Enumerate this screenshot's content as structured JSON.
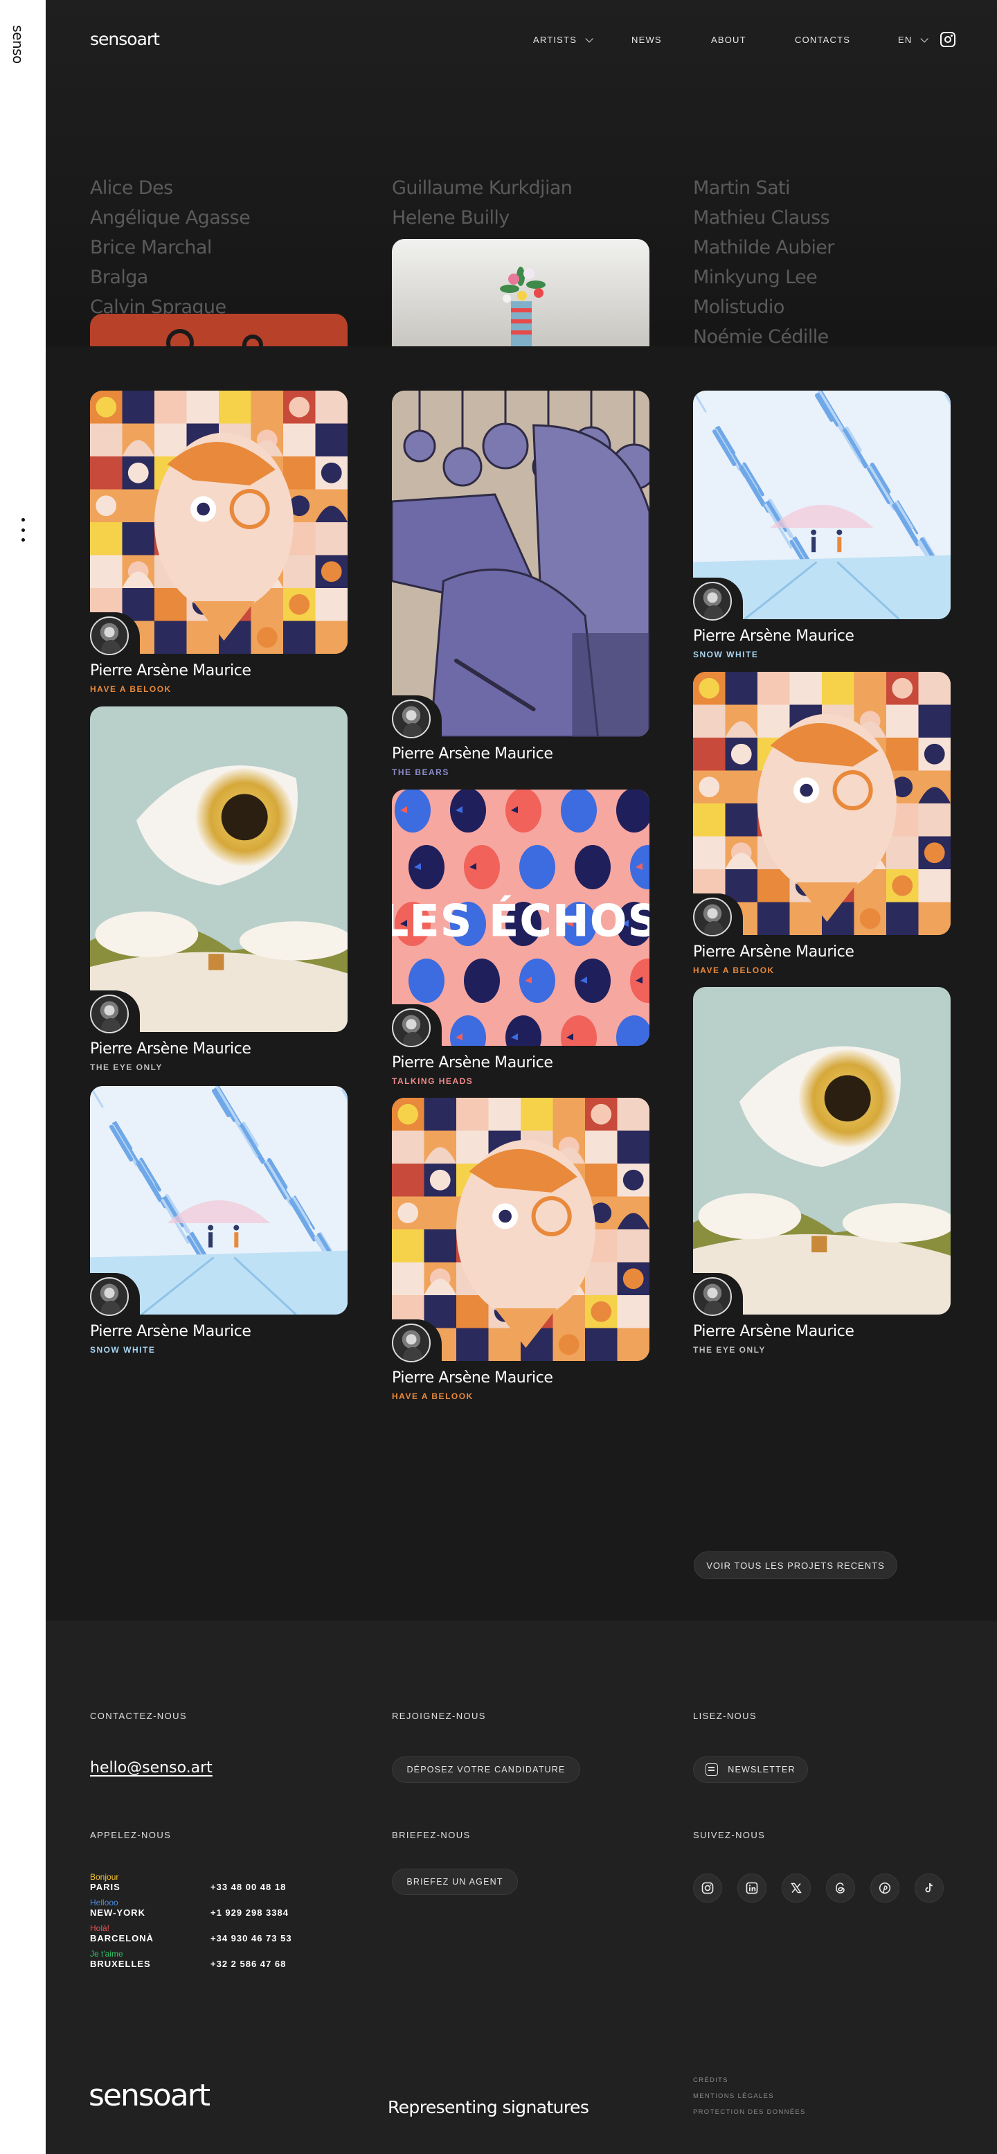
{
  "sidebar": {
    "logo": "senso"
  },
  "header": {
    "brand": "sensoart",
    "nav": [
      {
        "label": "ARTISTS",
        "dropdown": true
      },
      {
        "label": "NEWS"
      },
      {
        "label": "ABOUT"
      },
      {
        "label": "CONTACTS"
      },
      {
        "label": "EN",
        "dropdown": true
      }
    ]
  },
  "artists_menu": {
    "col1": [
      "Alice Des",
      "Angélique Agasse",
      "Brice Marchal",
      "Bralga",
      "Calvin Sprague"
    ],
    "col2": [
      "Guillaume Kurkdjian",
      "Helene Builly"
    ],
    "col3": [
      "Martin Sati",
      "Mathieu Clauss",
      "Mathilde Aubier",
      "Minkyung Lee",
      "Molistudio",
      "Noémie Cédille"
    ]
  },
  "cards": [
    {
      "artist": "Pierre Arsène Maurice",
      "project": "HAVE A BELOOK",
      "color": "#e8893c",
      "art": "belook"
    },
    {
      "artist": "Pierre Arsène Maurice",
      "project": "THE EYE ONLY",
      "color": "#bdbdbd",
      "art": "eye"
    },
    {
      "artist": "Pierre Arsène Maurice",
      "project": "SNOW WHITE",
      "color": "#a9d6f2",
      "art": "snow"
    },
    {
      "artist": "Pierre Arsène Maurice",
      "project": "THE BEARS",
      "color": "#8d8bc9",
      "art": "bears"
    },
    {
      "artist": "Pierre Arsène Maurice",
      "project": "TALKING HEADS",
      "color": "#f08a8a",
      "art": "echos",
      "art_text": "LES ÉCHOS"
    },
    {
      "artist": "Pierre Arsène Maurice",
      "project": "HAVE A BELOOK",
      "color": "#e8893c",
      "art": "belook"
    },
    {
      "artist": "Pierre Arsène Maurice",
      "project": "SNOW WHITE",
      "color": "#a9d6f2",
      "art": "snow"
    },
    {
      "artist": "Pierre Arsène Maurice",
      "project": "HAVE A BELOOK",
      "color": "#e8893c",
      "art": "belook"
    },
    {
      "artist": "Pierre Arsène Maurice",
      "project": "THE EYE ONLY",
      "color": "#bdbdbd",
      "art": "eye"
    }
  ],
  "see_all": "VOIR TOUS LES PROJETS RECENTS",
  "footer": {
    "contact_title": "CONTACTEZ-NOUS",
    "email": "hello@senso.art",
    "join_title": "REJOIGNEZ-NOUS",
    "apply_label": "DÉPOSEZ VOTRE CANDIDATURE",
    "read_title": "LISEZ-NOUS",
    "newsletter_label": "NEWSLETTER",
    "call_title": "APPELEZ-NOUS",
    "brief_title": "BRIEFEZ-NOUS",
    "brief_label": "BRIEFEZ UN AGENT",
    "follow_title": "SUIVEZ-NOUS",
    "phones": [
      {
        "hello": "Bonjour",
        "hello_color": "#f2c230",
        "city": "PARIS",
        "phone": "+33 48 00 48 18"
      },
      {
        "hello": "Hellooo",
        "hello_color": "#4a8de0",
        "city": "NEW-YORK",
        "phone": "+1 929 298 3384"
      },
      {
        "hello": "Holà!",
        "hello_color": "#e85454",
        "city": "BARCELONÀ",
        "phone": "+34 930 46 73 53"
      },
      {
        "hello": "Je t'aime",
        "hello_color": "#35c06a",
        "city": "BRUXELLES",
        "phone": "+32 2 586 47 68"
      }
    ],
    "social_icons": [
      "instagram-icon",
      "linkedin-icon",
      "x-icon",
      "threads-icon",
      "pinterest-icon",
      "tiktok-icon"
    ],
    "brand": "sensoart",
    "tagline": "Representing signatures",
    "legal": [
      "CRÉDITS",
      "MENTIONS LÉGALES",
      "PROTECTION DES DONNÉES"
    ]
  }
}
